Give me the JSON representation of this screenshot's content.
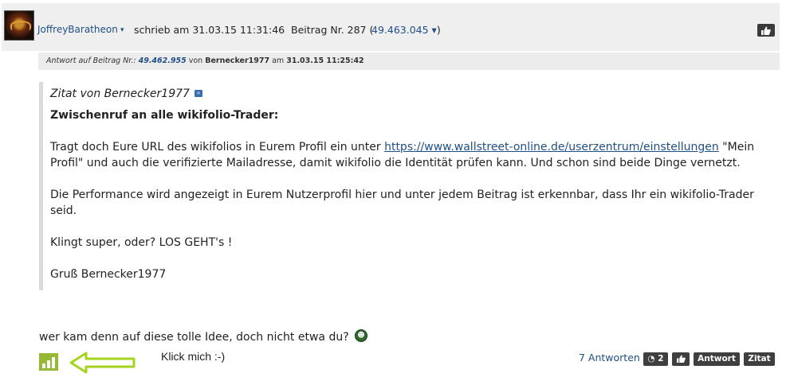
{
  "post": {
    "username": "JoffreyBaratheon",
    "user_caret": "▾",
    "wrote": "schrieb am 31.03.15 11:31:46",
    "post_no_label": "Beitrag Nr. 287 (",
    "post_id": "49.463.045 ▾",
    "post_id_close": ")",
    "like_icon": "thumbs-up"
  },
  "reply": {
    "prefix": "Antwort auf Beitrag Nr.:",
    "ref_id": "49.462.955",
    "from": "von",
    "author": "Bernecker1977",
    "at": "am",
    "datetime": "31.03.15 11:25:42"
  },
  "quote": {
    "head": "Zitat von Bernecker1977",
    "icon_glyph": "»",
    "title": "Zwischenruf an alle wikifolio-Trader:",
    "p1_before": "Tragt doch Eure URL des wikifolios in Eurem Profil ein unter ",
    "p1_link": "https://www.wallstreet-online.de/userzentrum/einstellungen",
    "p1_after": " \"Mein Profil\" und auch die verifizierte Mailadresse, damit wikifolio die Identität prüfen kann. Und schon sind beide Dinge vernetzt.",
    "p2": "Die Performance wird angezeigt in Eurem Nutzerprofil hier und unter jedem Beitrag ist erkennbar, dass Ihr ein wikifolio-Trader seid.",
    "p3": "Klingt super, oder? LOS GEHT's !",
    "p4": "Gruß Bernecker1977"
  },
  "body": {
    "text": "wer kam denn auf diese tolle Idee, doch nicht etwa du?",
    "smiley_glyph": "☻"
  },
  "footer": {
    "annotation": "Klick mich :-)",
    "answers": "7 Antworten",
    "rss_count": "2",
    "rss_glyph": "◔",
    "like_glyph": "👍",
    "antwort_label": "Antwort",
    "zitat_label": "Zitat"
  },
  "colors": {
    "link": "#1f4f86",
    "chart_icon": "#97b832",
    "arrow": "#a6d41e",
    "button": "#3f3f3f"
  }
}
